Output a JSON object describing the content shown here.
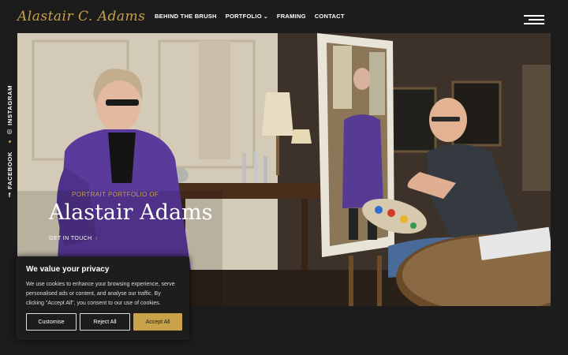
{
  "header": {
    "logo_text": "Alastair C. Adams",
    "nav": [
      {
        "label": "BEHIND THE BRUSH"
      },
      {
        "label": "PORTFOLIO",
        "has_dropdown": true
      },
      {
        "label": "FRAMING"
      },
      {
        "label": "CONTACT"
      }
    ],
    "menu_icon": "hamburger-icon"
  },
  "social": {
    "instagram_label": "INSTAGRAM",
    "facebook_label": "FACEBOOK",
    "instagram_icon": "instagram-icon",
    "facebook_icon": "facebook-icon"
  },
  "hero": {
    "subtitle": "PORTRAIT PORTFOLIO OF",
    "title": "Alastair Adams",
    "cta": "GET IN TOUCH",
    "cta_icon": "arrow-right-icon"
  },
  "cookie": {
    "title": "We value your privacy",
    "text": "We use cookies to enhance your browsing experience, serve personalised ads or content, and analyse our traffic. By clicking \"Accept All\", you consent to our use of cookies.",
    "customise_label": "Customise",
    "reject_label": "Reject All",
    "accept_label": "Accept All"
  },
  "colors": {
    "accent": "#c9a14a",
    "background": "#1c1c1c"
  }
}
